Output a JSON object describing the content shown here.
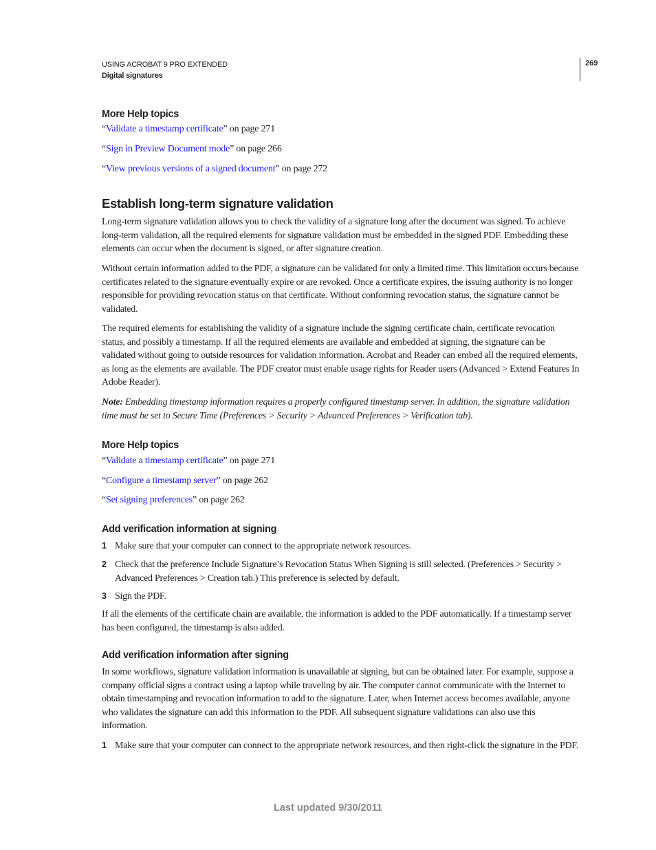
{
  "header": {
    "book_title": "USING ACROBAT 9 PRO EXTENDED",
    "chapter": "Digital signatures",
    "page_number": "269"
  },
  "more_help_1": {
    "heading": "More Help topics",
    "links": [
      {
        "open": "“",
        "label": "Validate a timestamp certificate",
        "suffix": "” on page 271"
      },
      {
        "open": "“",
        "label": "Sign in Preview Document mode",
        "suffix": "” on page 266"
      },
      {
        "open": "“",
        "label": "View previous versions of a signed document",
        "suffix": "” on page 272"
      }
    ]
  },
  "section": {
    "title": "Establish long-term signature validation",
    "paragraphs": [
      "Long-term signature validation allows you to check the validity of a signature long after the document was signed. To achieve long-term validation, all the required elements for signature validation must be embedded in the signed PDF. Embedding these elements can occur when the document is signed, or after signature creation.",
      "Without certain information added to the PDF, a signature can be validated for only a limited time. This limitation occurs because certificates related to the signature eventually expire or are revoked. Once a certificate expires, the issuing authority is no longer responsible for providing revocation status on that certificate. Without conforming revocation status, the signature cannot be validated.",
      "The required elements for establishing the validity of a signature include the signing certificate chain, certificate revocation status, and possibly a timestamp. If all the required elements are available and embedded at signing, the signature can be validated without going to outside resources for validation information. Acrobat and Reader can embed all the required elements, as long as the elements are available. The PDF creator must enable usage rights for Reader users (Advanced > Extend Features In Adobe Reader)."
    ],
    "note_label": "Note:",
    "note_text": " Embedding timestamp information requires a properly configured timestamp server. In addition, the signature validation time must be set to Secure Time (Preferences > Security > Advanced Preferences > Verification tab)."
  },
  "more_help_2": {
    "heading": "More Help topics",
    "links": [
      {
        "open": "“",
        "label": "Validate a timestamp certificate",
        "suffix": "” on page 271"
      },
      {
        "open": "“",
        "label": "Configure a timestamp server",
        "suffix": "” on page 262"
      },
      {
        "open": "“",
        "label": "Set signing preferences",
        "suffix": "” on page 262"
      }
    ]
  },
  "at_signing": {
    "title": "Add verification information at signing",
    "steps": [
      {
        "num": "1",
        "text": "Make sure that your computer can connect to the appropriate network resources."
      },
      {
        "num": "2",
        "text": "Check that the preference Include Signature’s Revocation Status When Signing is still selected. (Preferences > Security > Advanced Preferences > Creation tab.) This preference is selected by default."
      },
      {
        "num": "3",
        "text": "Sign the PDF."
      }
    ],
    "closing": "If all the elements of the certificate chain are available, the information is added to the PDF automatically. If a timestamp server has been configured, the timestamp is also added."
  },
  "after_signing": {
    "title": "Add verification information after signing",
    "intro": "In some workflows, signature validation information is unavailable at signing, but can be obtained later. For example, suppose a company official signs a contract using a laptop while traveling by air. The computer cannot communicate with the Internet to obtain timestamping and revocation information to add to the signature. Later, when Internet access becomes available, anyone who validates the signature can add this information to the PDF. All subsequent signature validations can also use this information.",
    "steps": [
      {
        "num": "1",
        "text": "Make sure that your computer can connect to the appropriate network resources, and then right-click the signature in the PDF."
      }
    ]
  },
  "footer": {
    "last_updated": "Last updated 9/30/2011"
  },
  "colors": {
    "link": "#1a1aff",
    "text": "#231f20",
    "footer": "#8a8a8a"
  }
}
